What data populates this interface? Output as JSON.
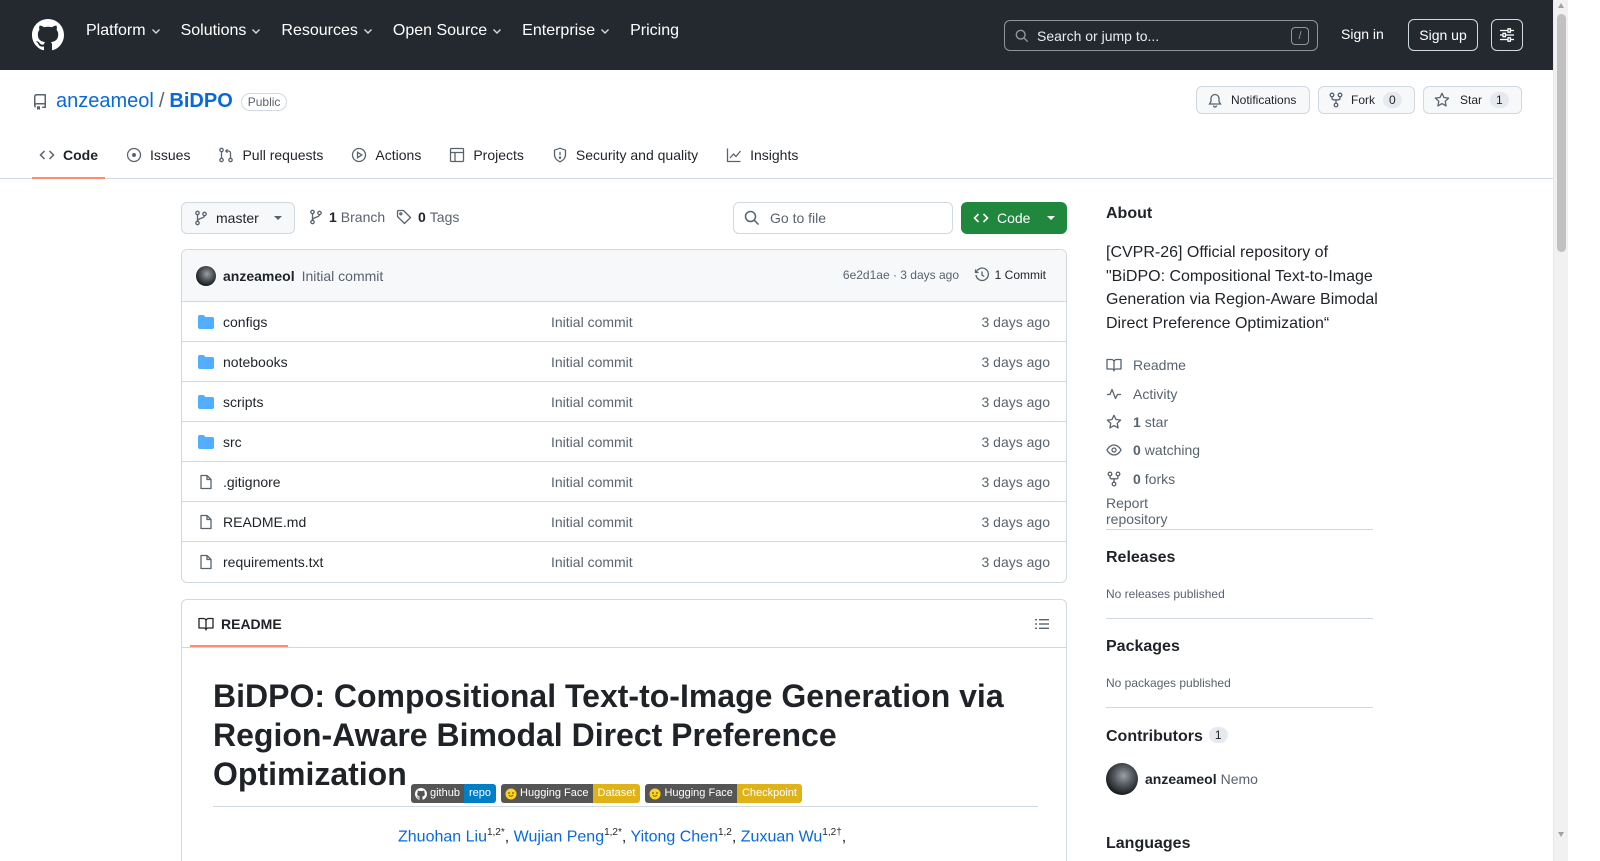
{
  "header": {
    "nav": [
      {
        "label": "Platform",
        "dropdown": true
      },
      {
        "label": "Solutions",
        "dropdown": true
      },
      {
        "label": "Resources",
        "dropdown": true
      },
      {
        "label": "Open Source",
        "dropdown": true
      },
      {
        "label": "Enterprise",
        "dropdown": true
      },
      {
        "label": "Pricing",
        "dropdown": false
      }
    ],
    "search_placeholder": "Search or jump to...",
    "search_key": "/",
    "sign_in": "Sign in",
    "sign_up": "Sign up"
  },
  "repo": {
    "owner": "anzeameol",
    "separator": "/",
    "name": "BiDPO",
    "visibility": "Public",
    "notifications_label": "Notifications",
    "fork_label": "Fork",
    "fork_count": "0",
    "star_label": "Star",
    "star_count": "1"
  },
  "tabs": [
    {
      "label": "Code",
      "icon": "code-icon",
      "selected": true
    },
    {
      "label": "Issues",
      "icon": "issue-icon",
      "selected": false
    },
    {
      "label": "Pull requests",
      "icon": "pull-request-icon",
      "selected": false
    },
    {
      "label": "Actions",
      "icon": "play-icon",
      "selected": false
    },
    {
      "label": "Projects",
      "icon": "table-icon",
      "selected": false
    },
    {
      "label": "Security and quality",
      "icon": "shield-icon",
      "selected": false
    },
    {
      "label": "Insights",
      "icon": "graph-icon",
      "selected": false
    }
  ],
  "toolbar": {
    "branch": "master",
    "branch_count": "1",
    "branch_label": "Branch",
    "tag_count": "0",
    "tag_label": "Tags",
    "go_to_file": "Go to file",
    "code_button": "Code"
  },
  "commit": {
    "author": "anzeameol",
    "message": "Initial commit",
    "sha_time": "6e2d1ae · 3 days ago",
    "commits_label": "1 Commit"
  },
  "files": [
    {
      "name": "configs",
      "type": "dir",
      "message": "Initial commit",
      "time": "3 days ago"
    },
    {
      "name": "notebooks",
      "type": "dir",
      "message": "Initial commit",
      "time": "3 days ago"
    },
    {
      "name": "scripts",
      "type": "dir",
      "message": "Initial commit",
      "time": "3 days ago"
    },
    {
      "name": "src",
      "type": "dir",
      "message": "Initial commit",
      "time": "3 days ago"
    },
    {
      "name": ".gitignore",
      "type": "file",
      "message": "Initial commit",
      "time": "3 days ago"
    },
    {
      "name": "README.md",
      "type": "file",
      "message": "Initial commit",
      "time": "3 days ago"
    },
    {
      "name": "requirements.txt",
      "type": "file",
      "message": "Initial commit",
      "time": "3 days ago"
    }
  ],
  "readme": {
    "tab_label": "README",
    "title": "BiDPO: Compositional Text-to-Image Generation via Region-Aware Bimodal Direct Preference Optimization",
    "badges": [
      {
        "left": "github",
        "right": "repo",
        "color": "#007ec6"
      },
      {
        "left": "Hugging Face",
        "right": "Dataset",
        "color": "#dfb317"
      },
      {
        "left": "Hugging Face",
        "right": "Checkpoint",
        "color": "#dfb317"
      }
    ],
    "authors": [
      {
        "name": "Zhuohan Liu",
        "sup": "1,2*"
      },
      {
        "name": "Wujian Peng",
        "sup": "1,2*"
      },
      {
        "name": "Yitong Chen",
        "sup": "1,2"
      },
      {
        "name": "Zuxuan Wu",
        "sup": "1,2†"
      }
    ]
  },
  "about": {
    "title": "About",
    "description": "[CVPR-26] Official repository of \"BiDPO: Compositional Text-to-Image Generation via Region-Aware Bimodal Direct Preference Optimization“",
    "readme": "Readme",
    "activity": "Activity",
    "stars_count": "1",
    "stars_label": "star",
    "watching_count": "0",
    "watching_label": "watching",
    "forks_count": "0",
    "forks_label": "forks",
    "report": "Report repository"
  },
  "releases": {
    "title": "Releases",
    "text": "No releases published"
  },
  "packages": {
    "title": "Packages",
    "text": "No packages published"
  },
  "contributors": {
    "title": "Contributors",
    "count": "1",
    "user": "anzeameol",
    "display_name": "Nemo"
  },
  "languages": {
    "title": "Languages"
  },
  "colors": {
    "header_bg": "#24292f",
    "link": "#0969da",
    "green": "#1f883d",
    "tab_underline": "#fd8c73",
    "folder": "#54aeff"
  }
}
